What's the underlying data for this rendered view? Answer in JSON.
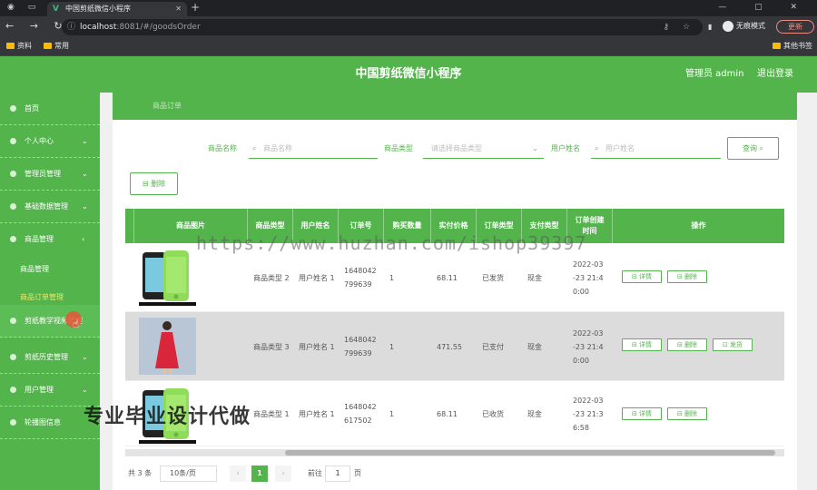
{
  "browser": {
    "tab_title": "中国剪纸微信小程序",
    "new_tab": "+",
    "window_controls": "— ▢ ✕",
    "url_host": "localhost",
    "url_rest": ":8081/#/goodsOrder",
    "incognito_label": "无痕模式",
    "update_label": "更新",
    "bookmarks": [
      "资料",
      "常用"
    ],
    "other_bookmarks": "其他书签"
  },
  "app": {
    "title": "中国剪纸微信小程序",
    "user_label": "管理员 admin",
    "logout": "退出登录"
  },
  "sidebar": {
    "items": [
      {
        "label": "首页",
        "arrow": ""
      },
      {
        "label": "个人中心",
        "arrow": "⌄"
      },
      {
        "label": "管理员管理",
        "arrow": "⌄"
      },
      {
        "label": "基础数据管理",
        "arrow": "⌄"
      },
      {
        "label": "商品管理",
        "arrow": "‹"
      },
      {
        "label": "剪纸教学视频管理",
        "arrow": ""
      },
      {
        "label": "剪纸历史管理",
        "arrow": "⌄"
      },
      {
        "label": "用户管理",
        "arrow": "⌄"
      },
      {
        "label": "轮播图信息",
        "arrow": ""
      }
    ],
    "subitems": [
      "商品管理",
      "商品订单管理"
    ]
  },
  "breadcrumb": "商品订单",
  "filters": {
    "goods_name_label": "商品名称",
    "goods_name_placeholder": "商品名称",
    "goods_type_label": "商品类型",
    "goods_type_placeholder": "请选择商品类型",
    "user_name_label": "用户姓名",
    "user_name_placeholder": "用户姓名",
    "query_button": "查询 ⌕",
    "delete_button": "⊟ 删除"
  },
  "table": {
    "headers": [
      "商品图片",
      "商品类型",
      "用户姓名",
      "订单号",
      "购买数量",
      "实付价格",
      "订单类型",
      "支付类型",
      "订单创建时间",
      "操作"
    ],
    "rows": [
      {
        "type": "商品类型 2",
        "user": "用户姓名 1",
        "order_no": "1648042 799639",
        "qty": "1",
        "price": "68.11",
        "order_type": "已发货",
        "pay": "现金",
        "time": "2022-03 -23 21:4 0:00",
        "actions": [
          "⊟ 详情",
          "⊟ 删除"
        ]
      },
      {
        "type": "商品类型 3",
        "user": "用户姓名 1",
        "order_no": "1648042 799639",
        "qty": "1",
        "price": "471.55",
        "order_type": "已支付",
        "pay": "现金",
        "time": "2022-03 -23 21:4 0:00",
        "actions": [
          "⊟ 详情",
          "⊟ 删除",
          "⊡ 发货"
        ]
      },
      {
        "type": "商品类型 1",
        "user": "用户姓名 1",
        "order_no": "1648042 617502",
        "qty": "1",
        "price": "68.11",
        "order_type": "已收货",
        "pay": "现金",
        "time": "2022-03 -23 21:3 6:58",
        "actions": [
          "⊟ 详情",
          "⊟ 删除"
        ]
      }
    ]
  },
  "pagination": {
    "total": "共 3 条",
    "page_size": "10条/页",
    "current": "1",
    "prev": "‹",
    "next": "›",
    "goto_label": "前往",
    "goto_value": "1",
    "page_unit": "页"
  },
  "watermarks": {
    "url": "https://www.huzhan.com/ishop39397",
    "slogan": "专业毕业设计代做"
  },
  "colors": {
    "accent": "#52b44b"
  }
}
